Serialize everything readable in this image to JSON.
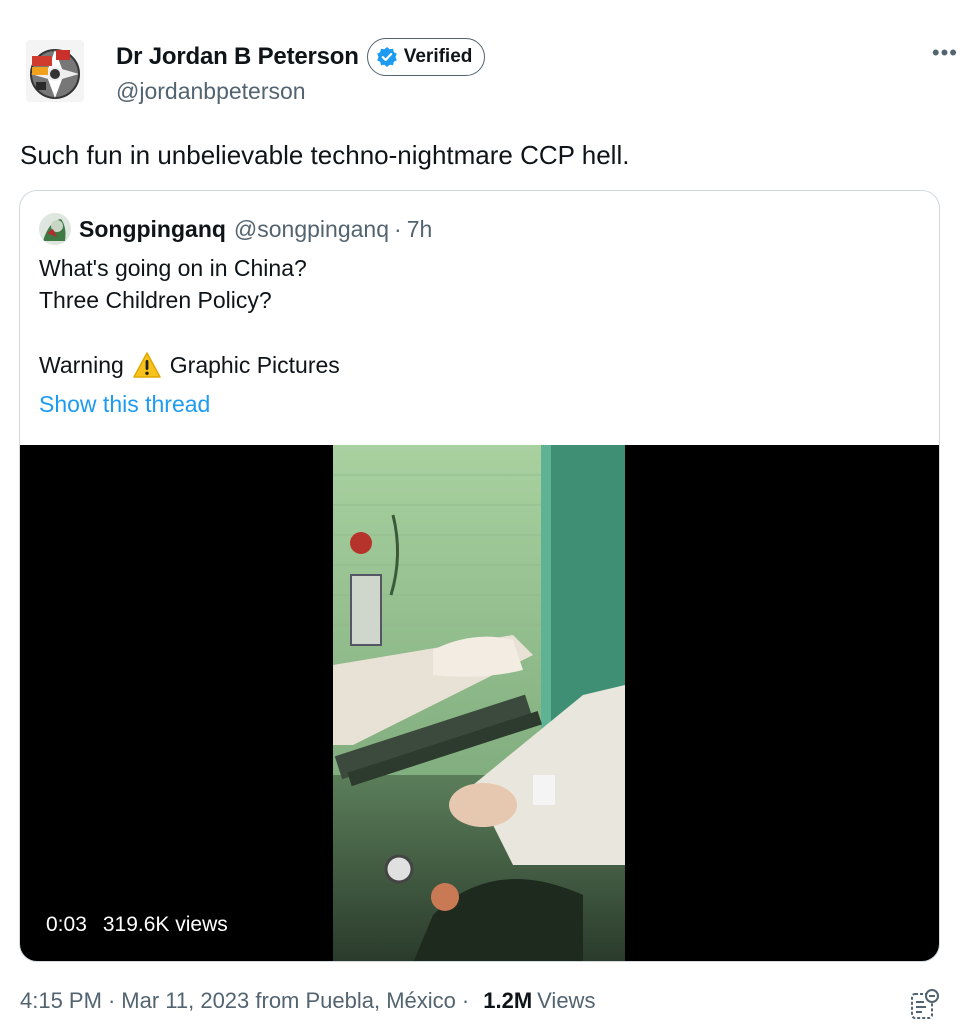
{
  "author": {
    "display_name": "Dr Jordan B Peterson",
    "verified_label": "Verified",
    "handle": "@jordanbpeterson"
  },
  "tweet": {
    "text": "Such fun in unbelievable techno-nightmare CCP hell."
  },
  "quoted": {
    "display_name": "Songpinganq",
    "handle": "@songpinganq",
    "separator": "·",
    "time": "7h",
    "line1": "What's going on in China?",
    "line2": "Three Children Policy?",
    "warning_before": "Warning",
    "warning_after": "Graphic Pictures",
    "show_thread": "Show this thread",
    "video": {
      "duration": "0:03",
      "views": "319.6K views"
    }
  },
  "footer": {
    "time": "4:15 PM",
    "dot1": "·",
    "date_location": "Mar 11, 2023 from Puebla, México",
    "dot2": "·",
    "views_count": "1.2M",
    "views_label": "Views"
  },
  "icons": {
    "verified": "verified-badge-icon",
    "more": "more-icon",
    "warning": "warning-icon",
    "analytics": "analytics-icon"
  },
  "colors": {
    "link": "#1d9bf0",
    "verified": "#1d9bf0",
    "secondary_text": "#536471"
  }
}
